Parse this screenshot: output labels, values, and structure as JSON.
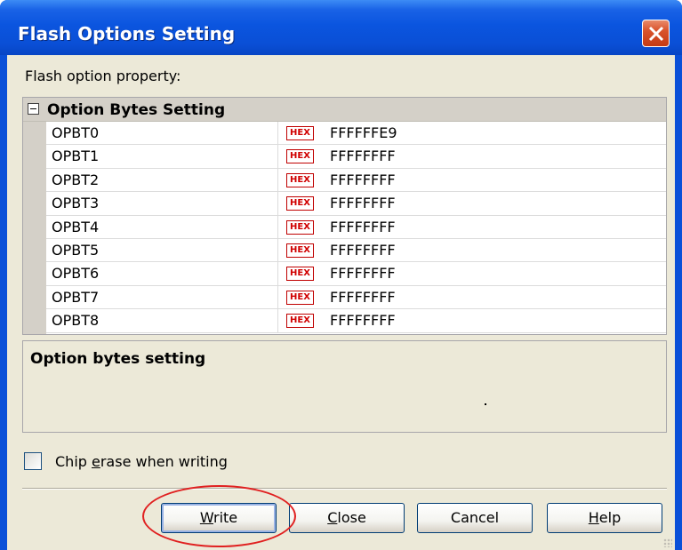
{
  "window": {
    "title": "Flash Options Setting"
  },
  "panel": {
    "property_label": "Flash option property:"
  },
  "grid": {
    "category": "Option Bytes Setting",
    "badge": "HEX",
    "rows": [
      {
        "name": "OPBT0",
        "value": "FFFFFFE9"
      },
      {
        "name": "OPBT1",
        "value": "FFFFFFFF"
      },
      {
        "name": "OPBT2",
        "value": "FFFFFFFF"
      },
      {
        "name": "OPBT3",
        "value": "FFFFFFFF"
      },
      {
        "name": "OPBT4",
        "value": "FFFFFFFF"
      },
      {
        "name": "OPBT5",
        "value": "FFFFFFFF"
      },
      {
        "name": "OPBT6",
        "value": "FFFFFFFF"
      },
      {
        "name": "OPBT7",
        "value": "FFFFFFFF"
      },
      {
        "name": "OPBT8",
        "value": "FFFFFFFF"
      }
    ]
  },
  "description": {
    "title": "Option bytes setting"
  },
  "checkbox": {
    "label_pre": "Chip ",
    "label_key": "e",
    "label_post": "rase when writing",
    "checked": false
  },
  "buttons": {
    "write": {
      "key": "W",
      "rest": "rite"
    },
    "close": {
      "key": "C",
      "rest": "lose"
    },
    "cancel": {
      "label": "Cancel"
    },
    "help": {
      "key": "H",
      "rest": "elp"
    }
  },
  "colors": {
    "title_bar": "#0a50d8",
    "dialog_bg": "#ece9d8",
    "highlight": "#e02020",
    "hex_badge": "#d00000"
  },
  "icons": {
    "close": "close-x-icon",
    "collapse": "minus-box-icon"
  }
}
